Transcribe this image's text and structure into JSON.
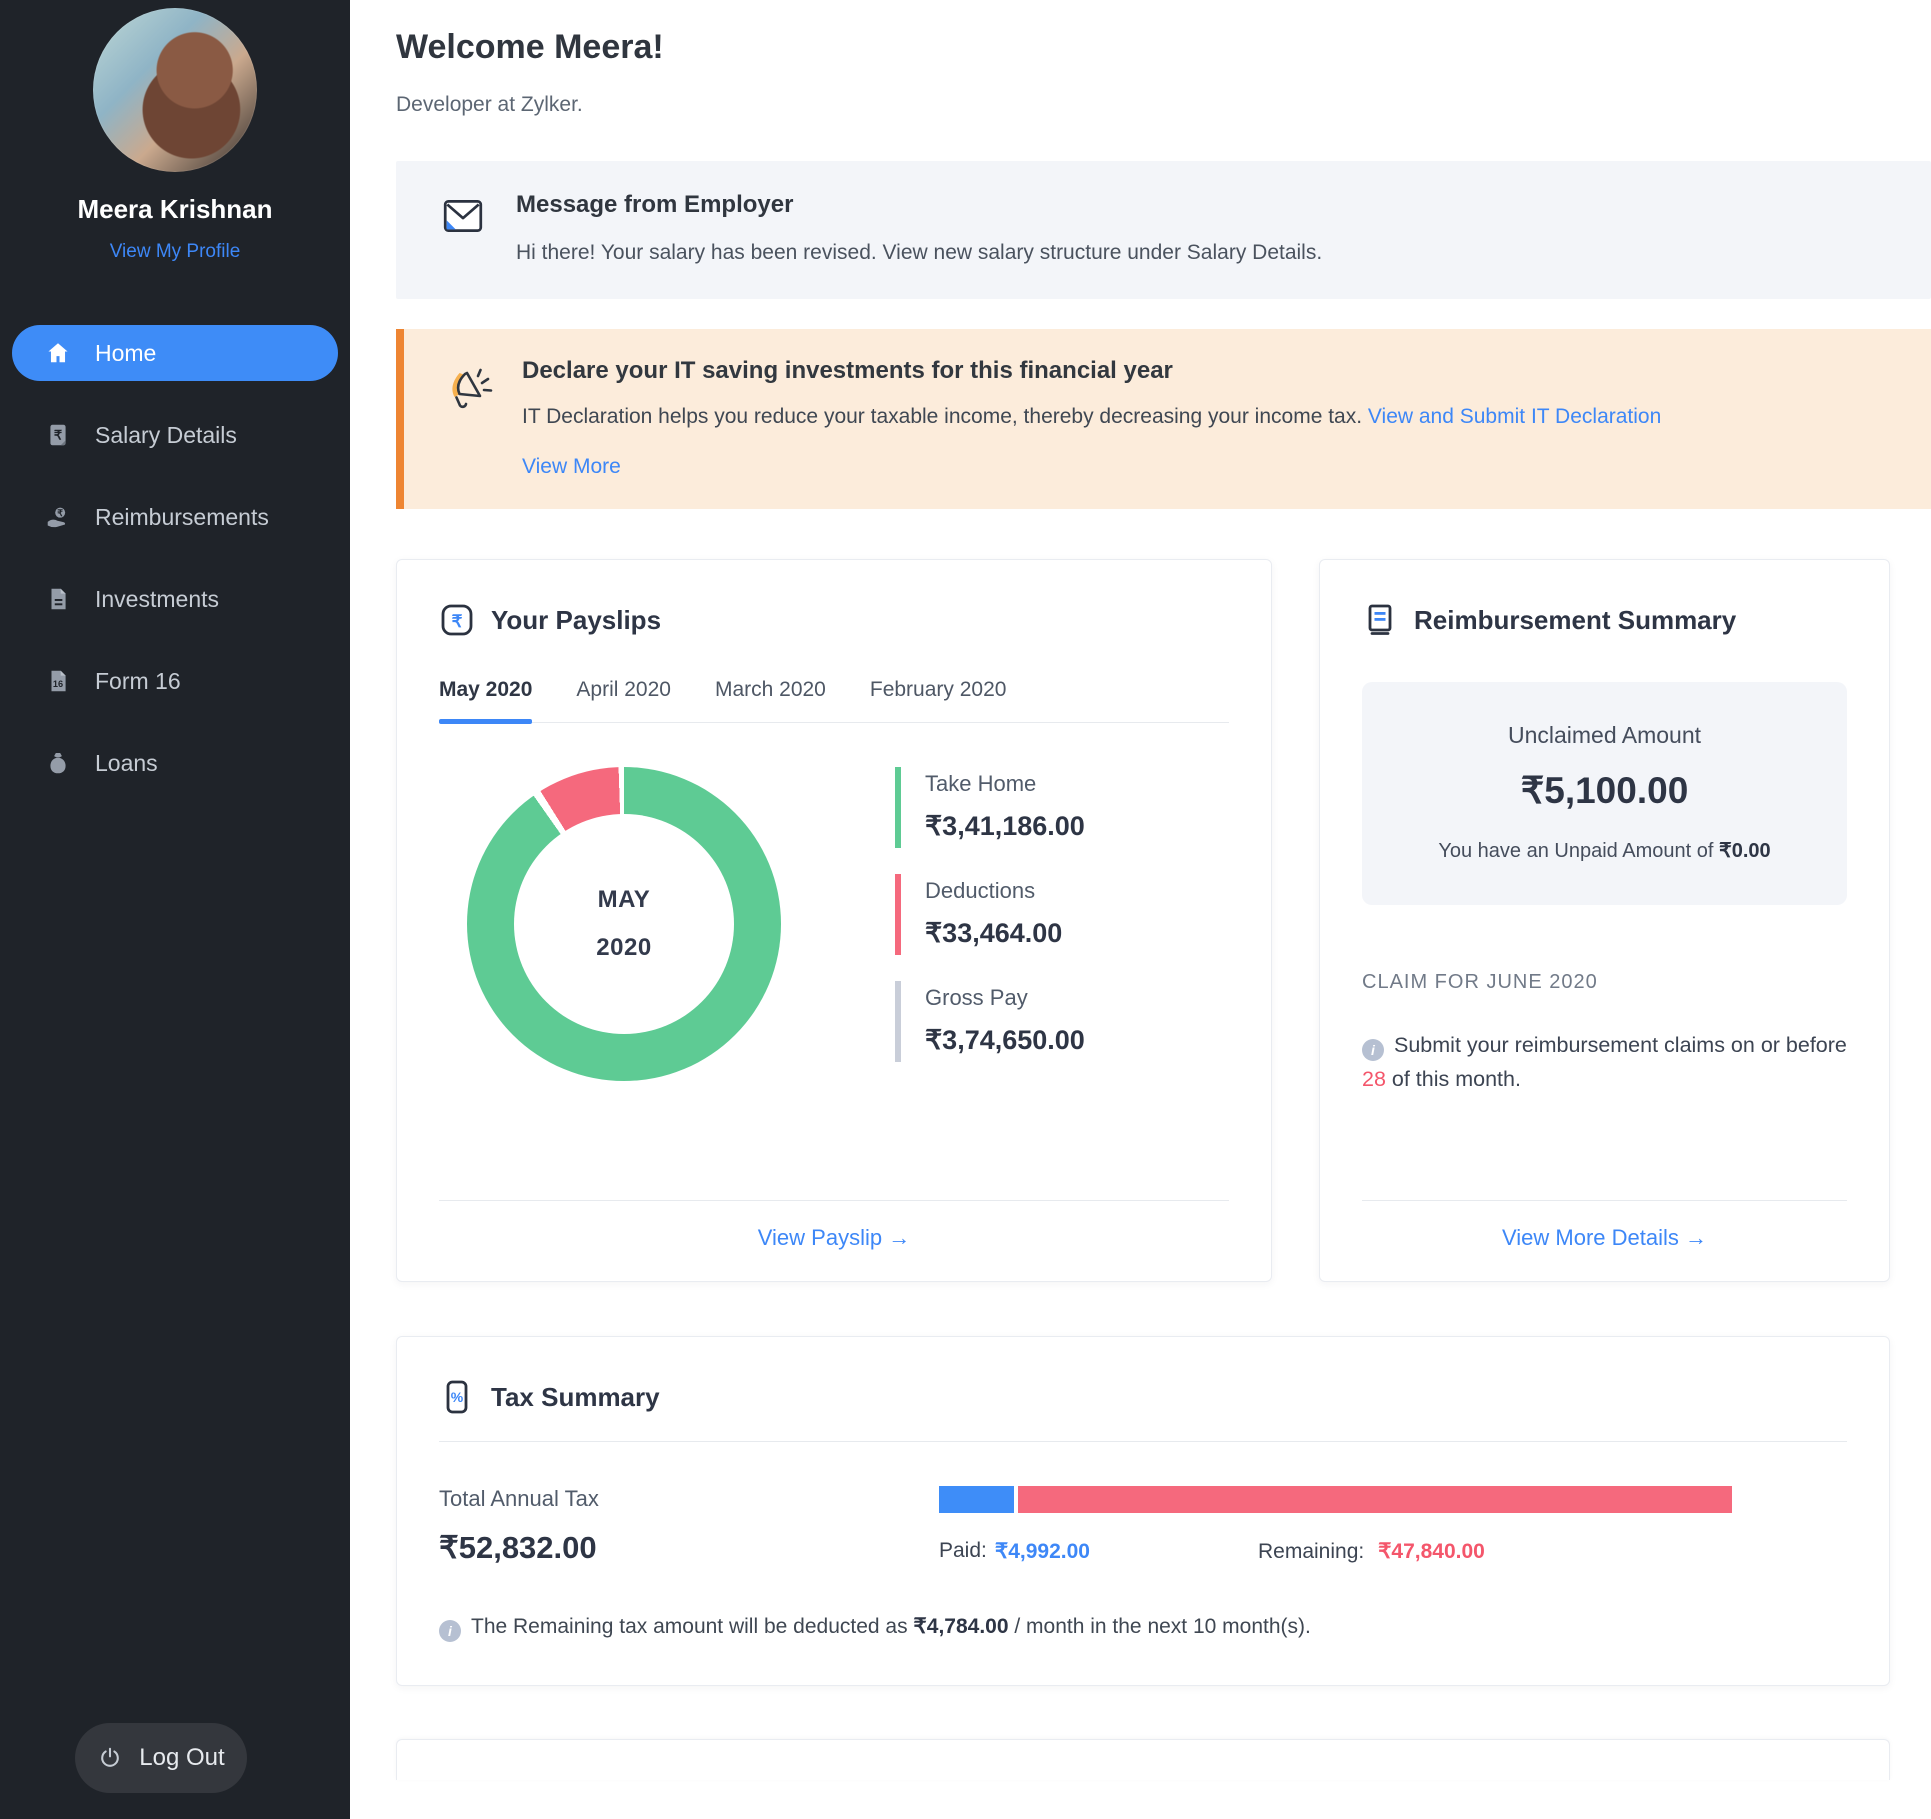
{
  "sidebar": {
    "name": "Meera Krishnan",
    "profile_link": "View My Profile",
    "items": [
      {
        "id": "home",
        "label": "Home"
      },
      {
        "id": "salary-details",
        "label": "Salary Details"
      },
      {
        "id": "reimbursements",
        "label": "Reimbursements"
      },
      {
        "id": "investments",
        "label": "Investments"
      },
      {
        "id": "form-16",
        "label": "Form 16"
      },
      {
        "id": "loans",
        "label": "Loans"
      }
    ],
    "logout_label": "Log Out"
  },
  "header": {
    "title": "Welcome Meera!",
    "subtitle": "Developer at Zylker."
  },
  "employer_message": {
    "title": "Message from Employer",
    "body": "Hi there! Your salary has been revised. View new salary structure under Salary Details."
  },
  "it_alert": {
    "title": "Declare your IT saving investments for this financial year",
    "body": "IT Declaration helps you reduce your taxable income, thereby decreasing your income tax. ",
    "link": "View and Submit IT Declaration",
    "more_link": "View More"
  },
  "payslips": {
    "title": "Your Payslips",
    "tabs": [
      "May 2020",
      "April 2020",
      "March 2020",
      "February 2020"
    ],
    "active_tab": "May 2020",
    "center_line1": "MAY",
    "center_line2": "2020",
    "legend": [
      {
        "label": "Take Home",
        "value": "₹3,41,186.00"
      },
      {
        "label": "Deductions",
        "value": "₹33,464.00"
      },
      {
        "label": "Gross Pay",
        "value": "₹3,74,650.00"
      }
    ],
    "link": "View Payslip",
    "link_arrow": "→"
  },
  "reimbursement": {
    "title": "Reimbursement Summary",
    "unclaimed_label": "Unclaimed Amount",
    "unclaimed_value": "₹5,100.00",
    "unpaid_prefix": "You have an Unpaid Amount of ",
    "unpaid_value": "₹0.00",
    "claim_heading": "CLAIM FOR JUNE 2020",
    "note_prefix": "Submit your reimbursement claims on or before ",
    "note_day": "28",
    "note_suffix": " of this month.",
    "link": "View More Details",
    "link_arrow": "→"
  },
  "tax": {
    "title": "Tax Summary",
    "total_label": "Total Annual Tax",
    "total_value": "₹52,832.00",
    "paid_label": "Paid:",
    "paid_value": "₹4,992.00",
    "remaining_label": "Remaining:",
    "remaining_value": "₹47,840.00",
    "note_prefix": "The Remaining tax amount will be deducted as ",
    "note_amount": "₹4,784.00",
    "note_suffix": " / month in the next 10 month(s)."
  },
  "colors": {
    "accent_blue": "#3d87f7",
    "sidebar_bg": "#1f2329",
    "active_pill": "#3e8cf7",
    "green": "#5ecb94",
    "red": "#f5697d",
    "gray_bar": "#c9ced9",
    "alert_bg": "#fcecdb",
    "alert_border": "#ee8532",
    "light_box": "#f3f5f9",
    "danger_text": "#f4566b"
  },
  "chart_data": [
    {
      "type": "pie",
      "title": "May 2020 payslip breakdown",
      "labels": [
        "Take Home",
        "Deductions"
      ],
      "values": [
        341186,
        33464
      ],
      "total_label": "Gross Pay",
      "total": 374650,
      "colors": [
        "#5ecb94",
        "#f5697d"
      ],
      "center_text": [
        "MAY",
        "2020"
      ],
      "legend_position": "right"
    },
    {
      "type": "bar",
      "title": "Tax Summary progress",
      "categories": [
        "Paid",
        "Remaining"
      ],
      "values": [
        4992,
        47840
      ],
      "total": 52832,
      "colors": [
        "#3e8df8",
        "#f5697d"
      ],
      "orientation": "horizontal-stacked"
    }
  ]
}
